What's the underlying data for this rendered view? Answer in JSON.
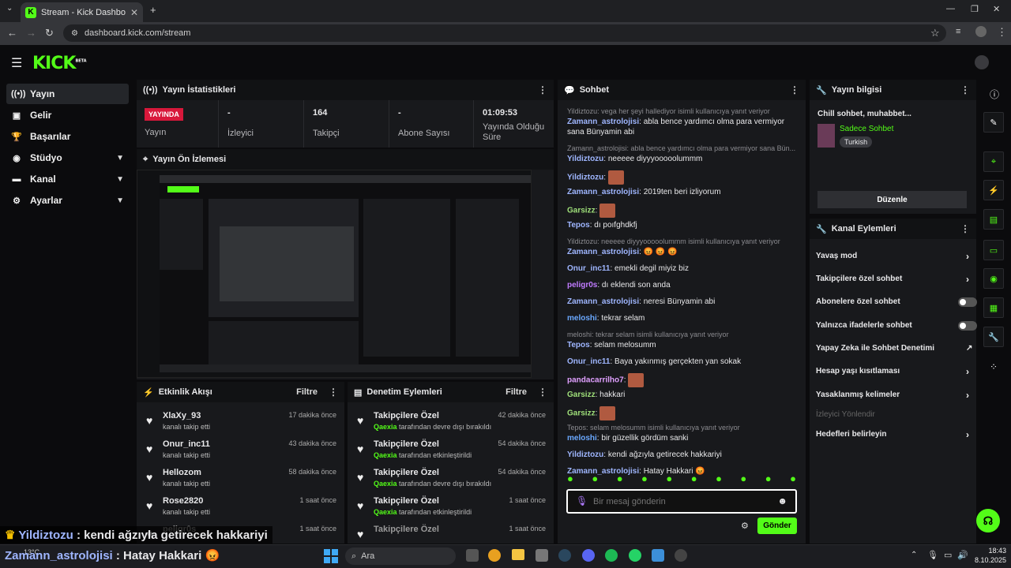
{
  "browser": {
    "tab_title": "Stream - Kick Dashboard",
    "url": "dashboard.kick.com/stream"
  },
  "brand": {
    "logo": "KICK",
    "beta": "BETA",
    "accent": "#53fc18",
    "live_color": "#d8183b"
  },
  "sidebar": {
    "items": [
      {
        "label": "Yayın",
        "icon": "broadcast-icon"
      },
      {
        "label": "Gelir",
        "icon": "money-icon"
      },
      {
        "label": "Başarılar",
        "icon": "trophy-icon"
      },
      {
        "label": "Stüdyo",
        "icon": "studio-icon"
      },
      {
        "label": "Kanal",
        "icon": "channel-icon"
      },
      {
        "label": "Ayarlar",
        "icon": "gear-icon"
      }
    ]
  },
  "stats": {
    "title": "Yayın İstatistikleri",
    "live_badge": "YAYINDA",
    "items": [
      {
        "value": "",
        "label": "Yayın"
      },
      {
        "value": "-",
        "label": "İzleyici"
      },
      {
        "value": "164",
        "label": "Takipçi"
      },
      {
        "value": "-",
        "label": "Abone Sayısı"
      },
      {
        "value": "01:09:53",
        "label": "Yayında Olduğu Süre"
      }
    ]
  },
  "preview": {
    "title": "Yayın Ön İzlemesi"
  },
  "events": {
    "title": "Etkinlik Akışı",
    "filter": "Filtre",
    "rows": [
      {
        "name": "XlaXy_93",
        "sub": "kanalı takip etti",
        "time": "17 dakika önce"
      },
      {
        "name": "Onur_inc11",
        "sub": "kanalı takip etti",
        "time": "43 dakika önce"
      },
      {
        "name": "Hellozom",
        "sub": "kanalı takip etti",
        "time": "58 dakika önce"
      },
      {
        "name": "Rose2820",
        "sub": "kanalı takip etti",
        "time": "1 saat önce"
      },
      {
        "name": "peligr0s",
        "sub": "",
        "time": "1 saat önce"
      }
    ]
  },
  "moderation": {
    "title": "Denetim Eylemleri",
    "filter": "Filtre",
    "rows": [
      {
        "name": "Takipçilere Özel",
        "user": "Qaexia",
        "sub": "tarafından devre dışı bırakıldı",
        "time": "42 dakika önce"
      },
      {
        "name": "Takipçilere Özel",
        "user": "Qaexia",
        "sub": "tarafından etkinleştirildi",
        "time": "54 dakika önce"
      },
      {
        "name": "Takipçilere Özel",
        "user": "Qaexia",
        "sub": "tarafından devre dışı bırakıldı",
        "time": "54 dakika önce"
      },
      {
        "name": "Takipçilere Özel",
        "user": "Qaexia",
        "sub": "tarafından etkinleştirildi",
        "time": "1 saat önce"
      },
      {
        "name": "Takipçilere Özel",
        "user": "",
        "sub": "",
        "time": "1 saat önce"
      }
    ]
  },
  "chat": {
    "title": "Sohbet",
    "placeholder": "Bir mesaj gönderin",
    "send": "Gönder",
    "lines": [
      {
        "reply": "Yildiztozu: vega her şeyi hallediyor isimli kullanıcıya yanıt veriyor"
      },
      {
        "user": "Zamann_astrolojisi",
        "color": "#9fb6ff",
        "text": "abla bence yardımcı olma para vermiyor sana Bünyamin abi"
      },
      {
        "reply": "Zamann_astrolojisi: abla bence yardımcı olma para vermiyor sana Bün..."
      },
      {
        "user": "Yildiztozu",
        "color": "#9fb6ff",
        "text": "neeeee diyyyooooolummm"
      },
      {
        "user": "Yildiztozu",
        "color": "#9fb6ff",
        "text": "",
        "emote": true
      },
      {
        "user": "Zamann_astrolojisi",
        "color": "#9fb6ff",
        "text": "2019ten beri izliyorum"
      },
      {
        "user": "Garsizz",
        "color": "#9fe07a",
        "text": "",
        "emote": true
      },
      {
        "user": "Tepos",
        "color": "#9fb6ff",
        "text": "dı poıfghdkfj"
      },
      {
        "reply": "Yildiztozu: neeeee diyyyooooolummm isimli kullanıcıya yanıt veriyor"
      },
      {
        "user": "Zamann_astrolojisi",
        "color": "#9fb6ff",
        "text": "😡 😡 😡"
      },
      {
        "user": "Onur_inc11",
        "color": "#9fb6ff",
        "text": "emekli degil miyiz biz"
      },
      {
        "user": "peligr0s",
        "color": "#c07bff",
        "text": "dı eklendi son anda"
      },
      {
        "user": "Zamann_astrolojisi",
        "color": "#9fb6ff",
        "text": "neresi Bünyamin abi"
      },
      {
        "user": "meloshi",
        "color": "#6aa8ff",
        "text": "tekrar selam"
      },
      {
        "reply": "meloshi: tekrar selam isimli kullanıcıya yanıt veriyor"
      },
      {
        "user": "Tepos",
        "color": "#9fb6ff",
        "text": "selam melosumm"
      },
      {
        "user": "Onur_inc11",
        "color": "#9fb6ff",
        "text": "Baya yakınmış gerçekten yan sokak"
      },
      {
        "user": "pandacarrilho7",
        "color": "#e0a0ff",
        "text": "",
        "emote": true
      },
      {
        "user": "Garsizz",
        "color": "#9fe07a",
        "text": "hakkari"
      },
      {
        "user": "Garsizz",
        "color": "#9fe07a",
        "text": "",
        "emote": true
      },
      {
        "reply": "Tepos: selam melosumm isimli kullanıcıya yanıt veriyor"
      },
      {
        "user": "meloshi",
        "color": "#6aa8ff",
        "text": "bir güzellik gördüm sanki"
      },
      {
        "user": "Yildiztozu",
        "color": "#9fb6ff",
        "text": "kendi ağzıyla getirecek hakkariyi"
      },
      {
        "user": "Zamann_astrolojisi",
        "color": "#9fb6ff",
        "text": "Hatay Hakkari 😡"
      }
    ]
  },
  "info": {
    "title": "Yayın bilgisi",
    "stream_title": "Chill sohbet, muhabbet...",
    "category": "Sadece Sohbet",
    "tag": "Turkish",
    "edit": "Düzenle"
  },
  "actions": {
    "title": "Kanal Eylemleri",
    "items": [
      {
        "label": "Yavaş mod",
        "type": "arrow"
      },
      {
        "label": "Takipçilere özel sohbet",
        "type": "arrow"
      },
      {
        "label": "Abonelere özel sohbet",
        "type": "toggle"
      },
      {
        "label": "Yalnızca ifadelerle sohbet",
        "type": "toggle"
      },
      {
        "label": "Yapay Zeka ile Sohbet Denetimi",
        "type": "ext"
      },
      {
        "label": "Hesap yaşı kısıtlaması",
        "type": "arrow"
      },
      {
        "label": "Yasaklanmış kelimeler",
        "type": "arrow"
      },
      {
        "label": "İzleyici Yönlendir",
        "type": "disabled"
      },
      {
        "label": "Hedefleri belirleyin",
        "type": "arrow"
      }
    ]
  },
  "overlay": {
    "line1_user": "Yildiztozu",
    "line1_text": " : kendi ağzıyla getirecek hakkariyi",
    "line2_user": "Zamann_astrolojisi",
    "line2_text": " : Hatay Hakkari 😡"
  },
  "taskbar": {
    "weather": "13°C",
    "search": "Ara",
    "time": "18:43",
    "date": "8.10.2025"
  }
}
